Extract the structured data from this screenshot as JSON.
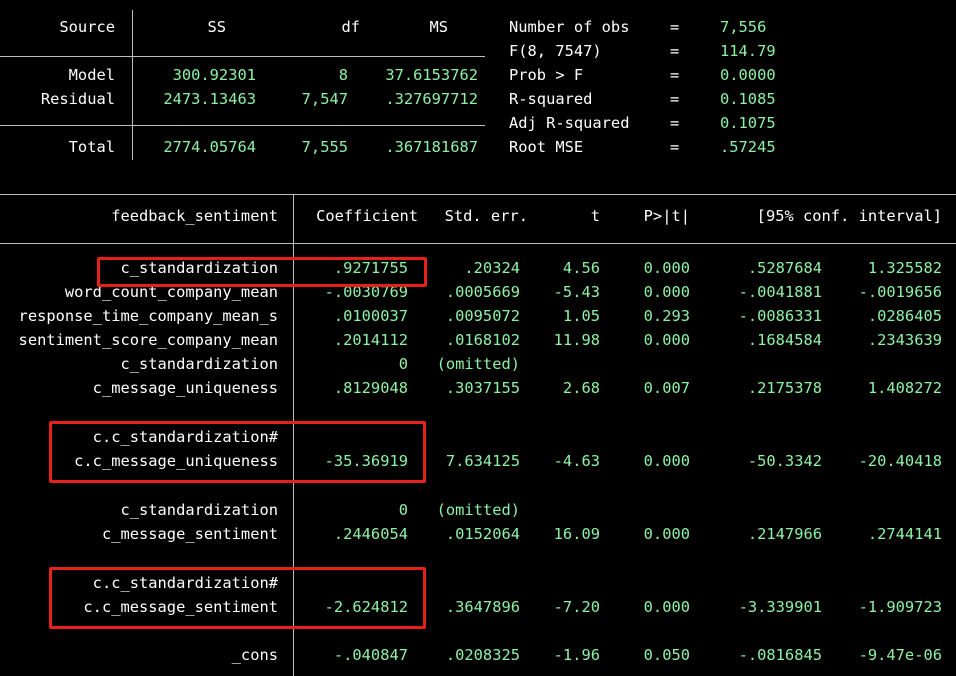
{
  "anova": {
    "headers": {
      "source": "Source",
      "ss": "SS",
      "df": "df",
      "ms": "MS"
    },
    "rows": [
      {
        "source": "Model",
        "ss": "300.92301",
        "df": "8",
        "ms": "37.6153762"
      },
      {
        "source": "Residual",
        "ss": "2473.13463",
        "df": "7,547",
        "ms": ".327697712"
      }
    ],
    "total": {
      "source": "Total",
      "ss": "2774.05764",
      "df": "7,555",
      "ms": ".367181687"
    }
  },
  "stats": [
    {
      "label": "Number of obs",
      "eq": "=",
      "value": "7,556"
    },
    {
      "label": "F(8, 7547)",
      "eq": "=",
      "value": "114.79"
    },
    {
      "label": "Prob > F",
      "eq": "=",
      "value": "0.0000"
    },
    {
      "label": "R-squared",
      "eq": "=",
      "value": "0.1085"
    },
    {
      "label": "Adj R-squared",
      "eq": "=",
      "value": "0.1075"
    },
    {
      "label": "Root MSE",
      "eq": "=",
      "value": ".57245"
    }
  ],
  "coef": {
    "headers": {
      "depvar": "feedback_sentiment",
      "coef": "Coefficient",
      "se": "Std. err.",
      "t": "t",
      "p": "P>|t|",
      "ci": "[95% conf. interval]"
    },
    "rows": [
      {
        "name": "c_standardization",
        "coef": ".9271755",
        "se": ".20324",
        "t": "4.56",
        "p": "0.000",
        "lo": ".5287684",
        "hi": "1.325582"
      },
      {
        "name": "word_count_company_mean",
        "coef": "-.0030769",
        "se": ".0005669",
        "t": "-5.43",
        "p": "0.000",
        "lo": "-.0041881",
        "hi": "-.0019656"
      },
      {
        "name": "response_time_company_mean_s",
        "coef": ".0100037",
        "se": ".0095072",
        "t": "1.05",
        "p": "0.293",
        "lo": "-.0086331",
        "hi": ".0286405"
      },
      {
        "name": "sentiment_score_company_mean",
        "coef": ".2014112",
        "se": ".0168102",
        "t": "11.98",
        "p": "0.000",
        "lo": ".1684584",
        "hi": ".2343639"
      },
      {
        "name": "c_standardization",
        "coef": "0",
        "se": "(omitted)",
        "t": "",
        "p": "",
        "lo": "",
        "hi": ""
      },
      {
        "name": "c_message_uniqueness",
        "coef": ".8129048",
        "se": ".3037155",
        "t": "2.68",
        "p": "0.007",
        "lo": ".2175378",
        "hi": "1.408272"
      },
      {
        "name": "c.c_standardization#",
        "coef": "",
        "se": "",
        "t": "",
        "p": "",
        "lo": "",
        "hi": ""
      },
      {
        "name": "c.c_message_uniqueness",
        "coef": "-35.36919",
        "se": "7.634125",
        "t": "-4.63",
        "p": "0.000",
        "lo": "-50.3342",
        "hi": "-20.40418"
      },
      {
        "name": "c_standardization",
        "coef": "0",
        "se": "(omitted)",
        "t": "",
        "p": "",
        "lo": "",
        "hi": ""
      },
      {
        "name": "c_message_sentiment",
        "coef": ".2446054",
        "se": ".0152064",
        "t": "16.09",
        "p": "0.000",
        "lo": ".2147966",
        "hi": ".2744141"
      },
      {
        "name": "c.c_standardization#",
        "coef": "",
        "se": "",
        "t": "",
        "p": "",
        "lo": "",
        "hi": ""
      },
      {
        "name": "c.c_message_sentiment",
        "coef": "-2.624812",
        "se": ".3647896",
        "t": "-7.20",
        "p": "0.000",
        "lo": "-3.339901",
        "hi": "-1.909723"
      },
      {
        "name": "_cons",
        "coef": "-.040847",
        "se": ".0208325",
        "t": "-1.96",
        "p": "0.050",
        "lo": "-.0816845",
        "hi": "-9.47e-06"
      }
    ]
  }
}
